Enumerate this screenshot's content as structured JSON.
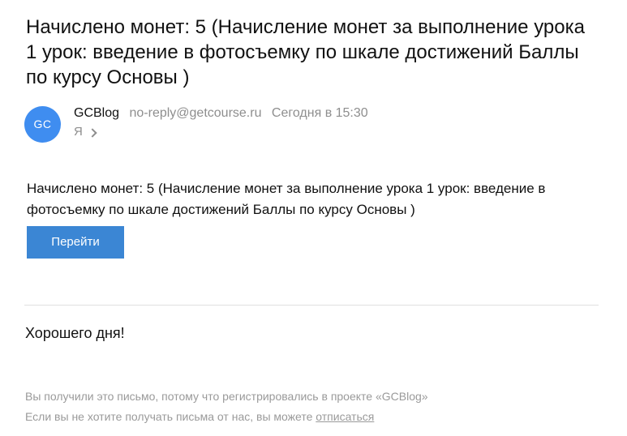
{
  "email": {
    "subject": "Начислено монет: 5 (Начисление монет за выполнение урока 1 урок: введение в фотосъемку по шкале достижений Баллы по курсу Основы )",
    "sender": {
      "avatar_initials": "GC",
      "avatar_color": "#3f8df0",
      "name": "GCBlog",
      "email": "no-reply@getcourse.ru",
      "date": "Сегодня в 15:30"
    },
    "recipient": "Я",
    "body_text": "Начислено монет: 5 (Начисление монет за выполнение урока 1 урок: введение в фотосъемку по шкале достижений Баллы по курсу Основы )",
    "button_label": "Перейти",
    "button_color": "#3b86d4",
    "greeting": "Хорошего дня!",
    "footer": {
      "line1": "Вы получили это письмо, потому что регистрировались в проекте «GCBlog»",
      "line2_prefix": "Если вы не хотите получать письма от нас, вы можете ",
      "unsubscribe_link": "отписаться"
    }
  }
}
